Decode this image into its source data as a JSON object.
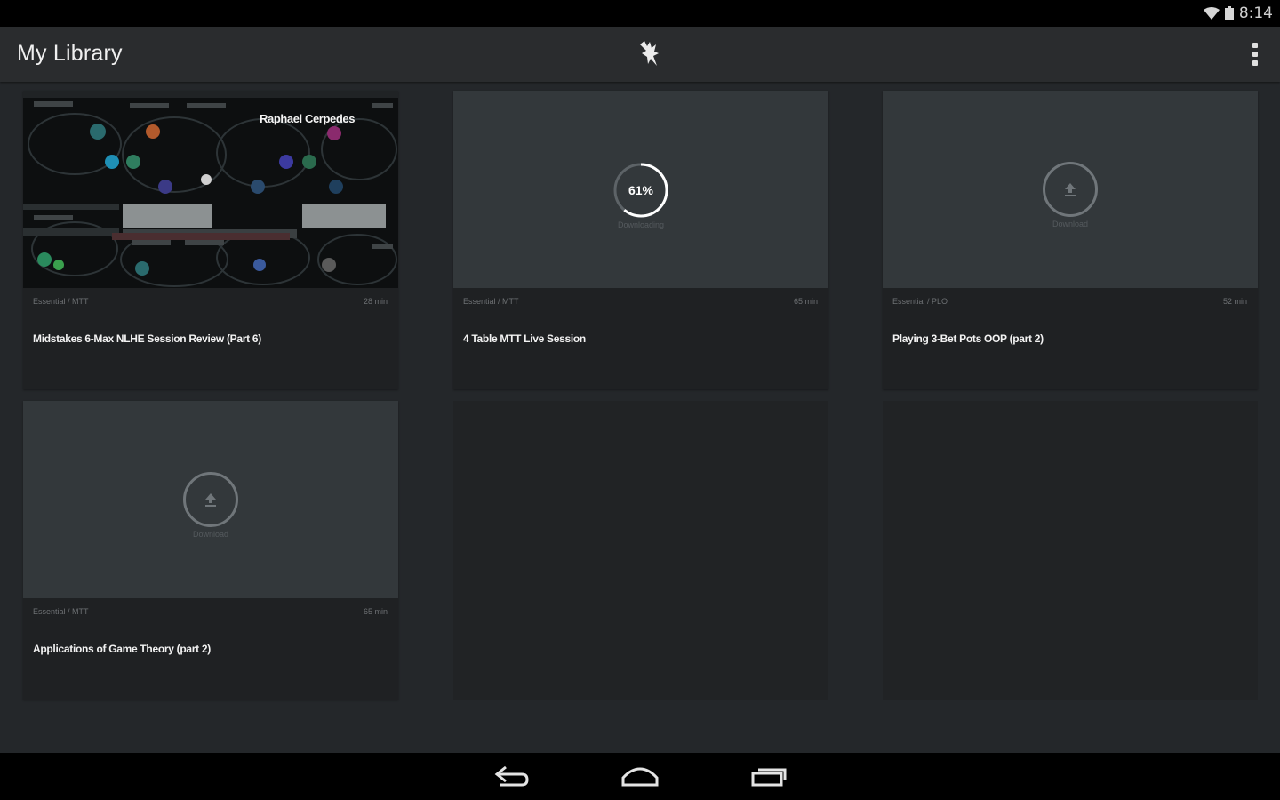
{
  "status_bar": {
    "time": "8:14",
    "icons": [
      "wifi-icon",
      "battery-icon"
    ]
  },
  "app_bar": {
    "title": "My Library",
    "logo_icon": "brand-logo-icon",
    "overflow_icon": "overflow-menu-icon"
  },
  "cards": [
    {
      "category": "Essential / MTT",
      "duration": "28 min",
      "title": "Midstakes 6-Max NLHE Session Review (Part 6)",
      "thumb_caption": "Raphael Cerpedes",
      "state": "downloaded"
    },
    {
      "category": "Essential / MTT",
      "duration": "65 min",
      "title": "4 Table MTT Live Session",
      "progress": 61,
      "progress_label": "61%",
      "state_label": "Downloading",
      "state": "downloading"
    },
    {
      "category": "Essential / PLO",
      "duration": "52 min",
      "title": "Playing 3-Bet Pots OOP (part 2)",
      "state_label": "Download",
      "state": "not-downloaded"
    },
    {
      "category": "Essential / MTT",
      "duration": "65 min",
      "title": "Applications of Game Theory (part 2)",
      "state_label": "Download",
      "state": "not-downloaded"
    }
  ],
  "nav_bar": {
    "icons": [
      "back-icon",
      "home-icon",
      "recent-apps-icon"
    ]
  },
  "colors": {
    "background": "#24272a",
    "app_bar": "#2a2c2e",
    "card": "#1f2123",
    "thumb": "#33383b",
    "progress_ring": "#ffffff",
    "progress_track": "#5d6367"
  }
}
